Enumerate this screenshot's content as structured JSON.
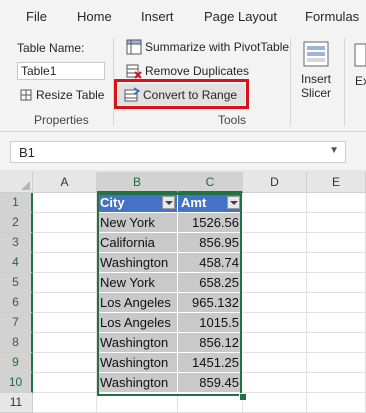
{
  "ribbon_tabs": [
    "File",
    "Home",
    "Insert",
    "Page Layout",
    "Formulas"
  ],
  "properties": {
    "table_name_label": "Table Name:",
    "table_name_value": "Table1",
    "resize_label": "Resize Table",
    "group_label": "Properties"
  },
  "tools": {
    "summarize_label": "Summarize with PivotTable",
    "remove_dup_label": "Remove Duplicates",
    "convert_label": "Convert to Range",
    "group_label": "Tools"
  },
  "slicer": {
    "line1": "Insert",
    "line2": "Slicer"
  },
  "export_partial": "Ex",
  "name_box": "B1",
  "columns": [
    "A",
    "B",
    "C",
    "D",
    "E"
  ],
  "rows": [
    "1",
    "2",
    "3",
    "4",
    "5",
    "6",
    "7",
    "8",
    "9",
    "10",
    "11"
  ],
  "table": {
    "headers": [
      "City",
      "Amt"
    ],
    "rows": [
      [
        "New York",
        "1526.56"
      ],
      [
        "California",
        "856.95"
      ],
      [
        "Washington",
        "458.74"
      ],
      [
        "New York",
        "658.25"
      ],
      [
        "Los Angeles",
        "965.132"
      ],
      [
        "Los Angeles",
        "1015.5"
      ],
      [
        "Washington",
        "856.12"
      ],
      [
        "Washington",
        "1451.25"
      ],
      [
        "Washington",
        "859.45"
      ]
    ]
  },
  "colors": {
    "accent_green": "#217346",
    "table_header": "#4472c4",
    "table_band": "#c9c9c9",
    "highlight_red": "#d9121a"
  }
}
